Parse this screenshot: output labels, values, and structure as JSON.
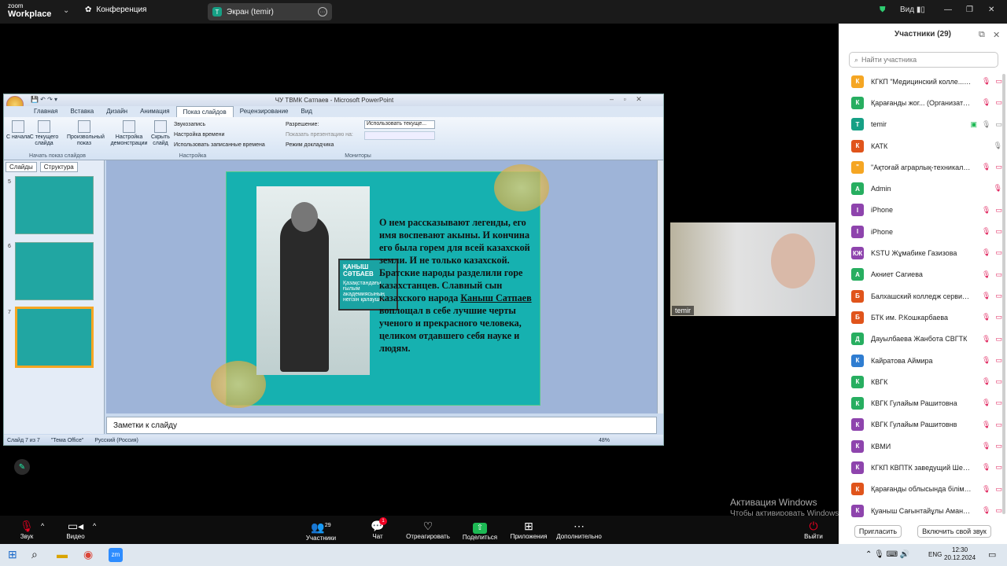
{
  "topbar": {
    "app_line1": "zoom",
    "app_line2": "Workplace",
    "meeting_label": "Конференция",
    "share_label": "Экран (temir)",
    "share_initial": "T",
    "view_label": "Вид"
  },
  "panel": {
    "title": "Участники (29)",
    "search_placeholder": "Найти участника",
    "invite": "Пригласить",
    "unmute_all": "Включить свой звук",
    "participants": [
      {
        "initial": "К",
        "color": "#f5a623",
        "name": "КГКП \"Медицинский колле... (Я)",
        "mic": "off",
        "cam": "off"
      },
      {
        "initial": "К",
        "color": "#27ae60",
        "name": "Қарағанды жог... (Организатор)",
        "mic": "off",
        "cam": "off"
      },
      {
        "initial": "T",
        "color": "#16a085",
        "name": "temir",
        "mic": "on",
        "cam": "share"
      },
      {
        "initial": "К",
        "color": "#e0541b",
        "name": "КАТК",
        "mic": "on",
        "cam": "none"
      },
      {
        "initial": "\"",
        "color": "#f5a623",
        "name": "\"Ақтоғай аграрлық-техникалы...",
        "mic": "off",
        "cam": "off"
      },
      {
        "initial": "A",
        "color": "#27ae60",
        "name": "Admin",
        "mic": "off",
        "cam": "none"
      },
      {
        "initial": "I",
        "color": "#8e44ad",
        "name": "iPhone",
        "mic": "off",
        "cam": "off"
      },
      {
        "initial": "I",
        "color": "#8e44ad",
        "name": "iPhone",
        "mic": "off",
        "cam": "off"
      },
      {
        "initial": "КЖ",
        "color": "#8e44ad",
        "name": "KSTU Жұмабике Газизова",
        "mic": "off",
        "cam": "off"
      },
      {
        "initial": "А",
        "color": "#27ae60",
        "name": "Акниет Сагиева",
        "mic": "off",
        "cam": "off"
      },
      {
        "initial": "Б",
        "color": "#e0541b",
        "name": "Балхашский колледж сервиса...",
        "mic": "off",
        "cam": "off"
      },
      {
        "initial": "Б",
        "color": "#e0541b",
        "name": "БТК им. Р.Кошкарбаева",
        "mic": "off",
        "cam": "off"
      },
      {
        "initial": "Д",
        "color": "#27ae60",
        "name": "Дауылбаева Жанбота СВГТК",
        "mic": "off",
        "cam": "off"
      },
      {
        "initial": "К",
        "color": "#2f7dd1",
        "name": "Кайратова Аймира",
        "mic": "off",
        "cam": "off"
      },
      {
        "initial": "К",
        "color": "#27ae60",
        "name": "КВГК",
        "mic": "off",
        "cam": "off"
      },
      {
        "initial": "К",
        "color": "#27ae60",
        "name": "КВГК Гулайым Рашитовна",
        "mic": "off",
        "cam": "off"
      },
      {
        "initial": "К",
        "color": "#8e44ad",
        "name": "КВГК Гулайым Рашитовнв",
        "mic": "off",
        "cam": "off"
      },
      {
        "initial": "К",
        "color": "#8e44ad",
        "name": "КВМИ",
        "mic": "off",
        "cam": "off"
      },
      {
        "initial": "К",
        "color": "#8e44ad",
        "name": "КГКП КВПТК заведущий Шем...",
        "mic": "off",
        "cam": "off"
      },
      {
        "initial": "К",
        "color": "#e0541b",
        "name": "Қарағанды облысында білім ...",
        "mic": "off",
        "cam": "off"
      },
      {
        "initial": "К",
        "color": "#8e44ad",
        "name": "Қуаныш Сағынтайұлы Аманқ...",
        "mic": "off",
        "cam": "off"
      }
    ]
  },
  "ppt": {
    "title": "ЧУ ТВМК Сатпаев - Microsoft PowerPoint",
    "tabs": [
      "Главная",
      "Вставка",
      "Дизайн",
      "Анимация",
      "Показ слайдов",
      "Рецензирование",
      "Вид"
    ],
    "ribbon": {
      "from_start": "С начала",
      "from_current": "С текущего слайда",
      "custom_show": "Произвольный показ",
      "group1": "Начать показ слайдов",
      "setup": "Настройка демонстрации",
      "hide": "Скрыть слайд",
      "record": "Звукозапись",
      "timings": "Настройка времени",
      "use_timings": "Использовать записанные времена",
      "group2": "Настройка",
      "resolution": "Разрешение:",
      "resolution_val": "Использовать текуще...",
      "show_on": "Показать презентацию на:",
      "presenter": "Режим докладчика",
      "group3": "Мониторы"
    },
    "pane_tabs": [
      "Слайды",
      "Структура"
    ],
    "thumb_nums": [
      "5",
      "6",
      "7"
    ],
    "slide": {
      "name_title": "ҚАНЫШ СӘТБАЕВ",
      "name_sub": "Қазақстандағы ғылым академиясының негізін қалаушы",
      "text_a": "О нем рассказывают легенды, его имя воспевают акыны. И кончина его была горем для всей казахской земли. И не только казахской. Братские народы разделили горе казахстанцев.  Славный сын казахского народа ",
      "text_u": "Каныш Сатпаев",
      "text_b": " воплощал в себе лучшие черты ученого и прекрасного человека, целиком отдавшего себя науке и людям."
    },
    "notes": "Заметки к слайду",
    "status": {
      "slide": "Слайд 7 из 7",
      "theme": "\"Тема Office\"",
      "lang": "Русский (Россия)",
      "zoom": "48%"
    }
  },
  "cam": {
    "name": "temir"
  },
  "toolbar": {
    "audio": "Звук",
    "video": "Видео",
    "participants": "Участники",
    "participants_count": "29",
    "chat": "Чат",
    "chat_badge": "1",
    "react": "Отреагировать",
    "share": "Поделиться",
    "apps": "Приложения",
    "more": "Дополнительно",
    "leave": "Выйти"
  },
  "watermark": {
    "line1": "Активация Windows",
    "line2": "Чтобы активировать Windows, перейдите в раздел \"Параметры\"."
  },
  "taskbar": {
    "lang": "ENG",
    "time": "12:30",
    "date": "20.12.2024"
  }
}
